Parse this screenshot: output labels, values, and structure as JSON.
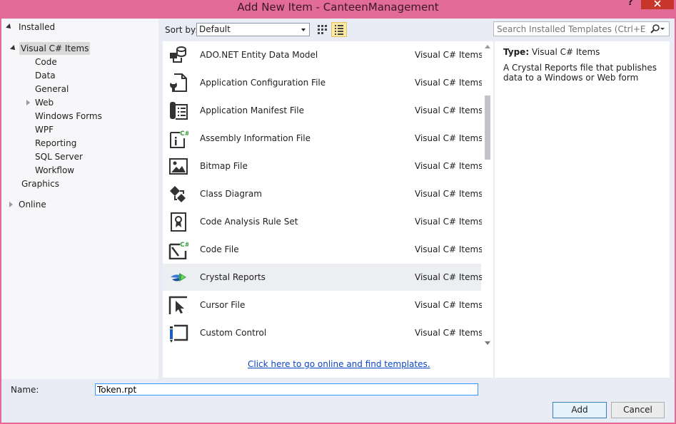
{
  "window": {
    "title": "Add New Item - CanteenManagement",
    "help_glyph": "?"
  },
  "tree": {
    "installed": "Installed",
    "visual_csharp_items": "Visual C# Items",
    "children": [
      "Code",
      "Data",
      "General",
      "Web",
      "Windows Forms",
      "WPF",
      "Reporting",
      "SQL Server",
      "Workflow"
    ],
    "graphics": "Graphics",
    "online": "Online"
  },
  "toolbar": {
    "sort_label": "Sort by:",
    "sort_value": "Default",
    "search_placeholder": "Search Installed Templates (Ctrl+E)"
  },
  "items": [
    {
      "name": "ADO.NET Entity Data Model",
      "category": "Visual C# Items",
      "icon": "entity-model-icon"
    },
    {
      "name": "Application Configuration File",
      "category": "Visual C# Items",
      "icon": "config-file-icon"
    },
    {
      "name": "Application Manifest File",
      "category": "Visual C# Items",
      "icon": "manifest-file-icon"
    },
    {
      "name": "Assembly Information File",
      "category": "Visual C# Items",
      "icon": "assembly-info-icon"
    },
    {
      "name": "Bitmap File",
      "category": "Visual C# Items",
      "icon": "bitmap-icon"
    },
    {
      "name": "Class Diagram",
      "category": "Visual C# Items",
      "icon": "class-diagram-icon"
    },
    {
      "name": "Code Analysis Rule Set",
      "category": "Visual C# Items",
      "icon": "rule-set-icon"
    },
    {
      "name": "Code File",
      "category": "Visual C# Items",
      "icon": "code-file-icon"
    },
    {
      "name": "Crystal Reports",
      "category": "Visual C# Items",
      "icon": "crystal-reports-icon"
    },
    {
      "name": "Cursor File",
      "category": "Visual C# Items",
      "icon": "cursor-file-icon"
    },
    {
      "name": "Custom Control",
      "category": "Visual C# Items",
      "icon": "custom-control-icon"
    }
  ],
  "online_link": "Click here to go online and find templates.",
  "details": {
    "type_label": "Type:",
    "type_value": "Visual C# Items",
    "description": "A Crystal Reports file that publishes data to a Windows or Web form"
  },
  "footer": {
    "name_label": "Name:",
    "name_value": "Token.rpt",
    "add_label": "Add",
    "cancel_label": "Cancel"
  }
}
